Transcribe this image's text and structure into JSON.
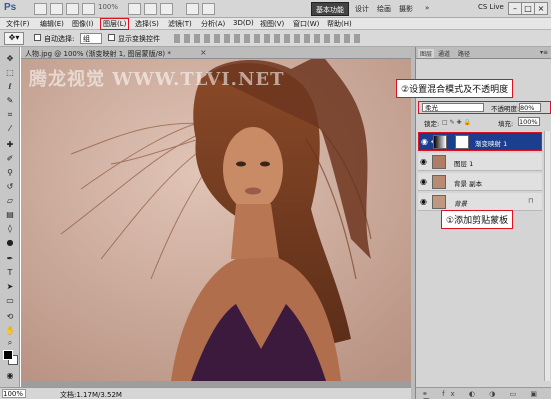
{
  "appbar": {
    "logo": "Ps",
    "zoom": "100%",
    "workspace": "基本功能",
    "links": [
      "设计",
      "绘画",
      "摄影"
    ],
    "cs_live": "CS Live"
  },
  "menu": {
    "items": [
      "文件(F)",
      "编辑(E)",
      "图像(I)",
      "图层(L)",
      "选择(S)",
      "滤镜(T)",
      "分析(A)",
      "3D(D)",
      "视图(V)",
      "窗口(W)",
      "帮助(H)"
    ]
  },
  "options": {
    "auto_select_label": "自动选择:",
    "auto_select_value": "组",
    "show_transform_label": "显示变换控件"
  },
  "document": {
    "tab_title": "人物.jpg @ 100% (渐变映射 1, 图层蒙版/8) *",
    "tab_close": "×",
    "watermark": "腾龙视觉 WWW.TLVI.NET"
  },
  "status": {
    "zoom": "100%",
    "doc_info": "文档:1.17M/3.52M"
  },
  "panel": {
    "tabs": [
      "图层",
      "通道",
      "路径"
    ],
    "blend_mode": "柔光",
    "opacity_label": "不透明度:",
    "opacity_value": "80%",
    "lock_label": "锁定:",
    "lock_icons": "□ ✎ ✚ 🔒",
    "fill_label": "填充:",
    "fill_value": "100%",
    "layers": [
      {
        "name": "渐变映射 1",
        "selected": true
      },
      {
        "name": "图层 1",
        "selected": false
      },
      {
        "name": "背景 副本",
        "selected": false
      },
      {
        "name": "背景",
        "selected": false
      }
    ],
    "footer_icons": "⚭ fx ◐ ◑ ▭ ▣ 🗑"
  },
  "callouts": {
    "blend": "②设置混合模式及不透明度",
    "clip": "①添加剪贴蒙板"
  },
  "colors": {
    "highlight_red": "#dd1122",
    "selected_layer": "#1c3e8e",
    "workspace_bg": "#444444"
  }
}
